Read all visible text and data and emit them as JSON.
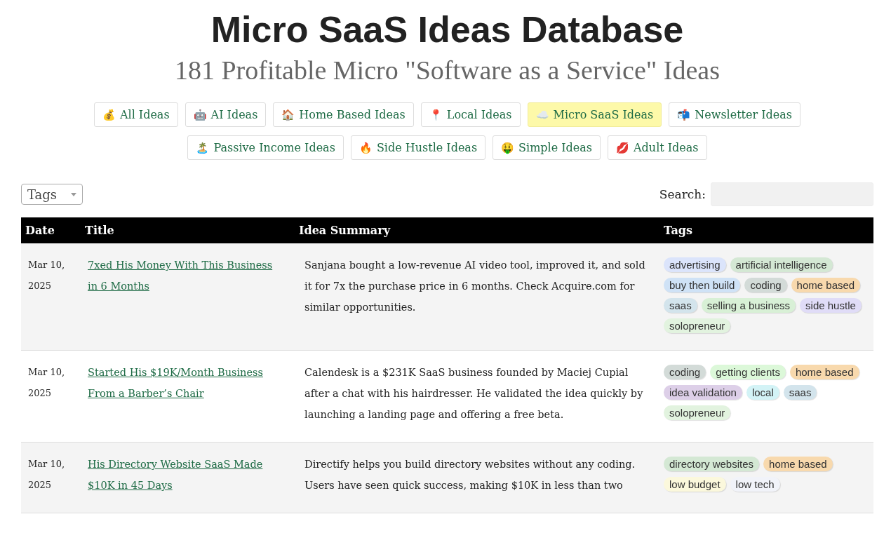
{
  "header": {
    "title": "Micro SaaS Ideas Database",
    "subtitle": "181 Profitable Micro \"Software as a Service\" Ideas"
  },
  "categories": [
    {
      "icon": "💰",
      "label": "All Ideas",
      "selected": false
    },
    {
      "icon": "🤖",
      "label": "AI Ideas",
      "selected": false
    },
    {
      "icon": "🏠",
      "label": "Home Based Ideas",
      "selected": false
    },
    {
      "icon": "📍",
      "label": "Local Ideas",
      "selected": false
    },
    {
      "icon": "☁️",
      "label": "Micro SaaS Ideas",
      "selected": true
    },
    {
      "icon": "📬",
      "label": "Newsletter Ideas",
      "selected": false
    },
    {
      "icon": "🏝️",
      "label": "Passive Income Ideas",
      "selected": false
    },
    {
      "icon": "🔥",
      "label": "Side Hustle Ideas",
      "selected": false
    },
    {
      "icon": "🤑",
      "label": "Simple Ideas",
      "selected": false
    },
    {
      "icon": "💋",
      "label": "Adult Ideas",
      "selected": false
    }
  ],
  "filter": {
    "tags_select": "Tags",
    "search_label": "Search:"
  },
  "table": {
    "columns": [
      "Date",
      "Title",
      "Idea Summary",
      "Tags"
    ],
    "rows": [
      {
        "date": "Mar 10, 2025",
        "title": "7xed His Money With This Business in 6 Months",
        "summary": "Sanjana bought a low-revenue AI video tool, improved it, and sold it for 7x the purchase price in 6 months. Check Acquire.com for similar opportunities.",
        "tags": [
          {
            "label": "advertising",
            "color": "#dbe4fb"
          },
          {
            "label": "artificial intelligence",
            "color": "#d4e8d4"
          },
          {
            "label": "buy then build",
            "color": "#cfe2f6"
          },
          {
            "label": "coding",
            "color": "#d3dbd8"
          },
          {
            "label": "home based",
            "color": "#f8d9ad"
          },
          {
            "label": "saas",
            "color": "#d3e4ec"
          },
          {
            "label": "selling a business",
            "color": "#d8f0d6"
          },
          {
            "label": "side hustle",
            "color": "#e0dcf7"
          },
          {
            "label": "solopreneur",
            "color": "#e2f3df"
          }
        ]
      },
      {
        "date": "Mar 10, 2025",
        "title": "Started His $19K/Month Business From a Barber’s Chair",
        "summary": "Calendesk is a $231K SaaS business founded by Maciej Cupial after a chat with his hairdresser. He validated the idea quickly by launching a landing page and offering a free beta.",
        "tags": [
          {
            "label": "coding",
            "color": "#d3dbd8"
          },
          {
            "label": "getting clients",
            "color": "#dcf8d9"
          },
          {
            "label": "home based",
            "color": "#f8d9ad"
          },
          {
            "label": "idea validation",
            "color": "#ddcfe8"
          },
          {
            "label": "local",
            "color": "#d3f3f6"
          },
          {
            "label": "saas",
            "color": "#d3e4ec"
          },
          {
            "label": "solopreneur",
            "color": "#e2f3df"
          }
        ]
      },
      {
        "date": "Mar 10, 2025",
        "title": "His Directory Website SaaS Made $10K in 45 Days",
        "summary": "Directify helps you build directory websites without any coding. Users have seen quick success, making $10K in less than two",
        "tags": [
          {
            "label": "directory websites",
            "color": "#d4e8d4"
          },
          {
            "label": "home based",
            "color": "#f8d9ad"
          },
          {
            "label": "low budget",
            "color": "#fbf8dc"
          },
          {
            "label": "low tech",
            "color": "#f1f3f9"
          }
        ]
      }
    ]
  }
}
